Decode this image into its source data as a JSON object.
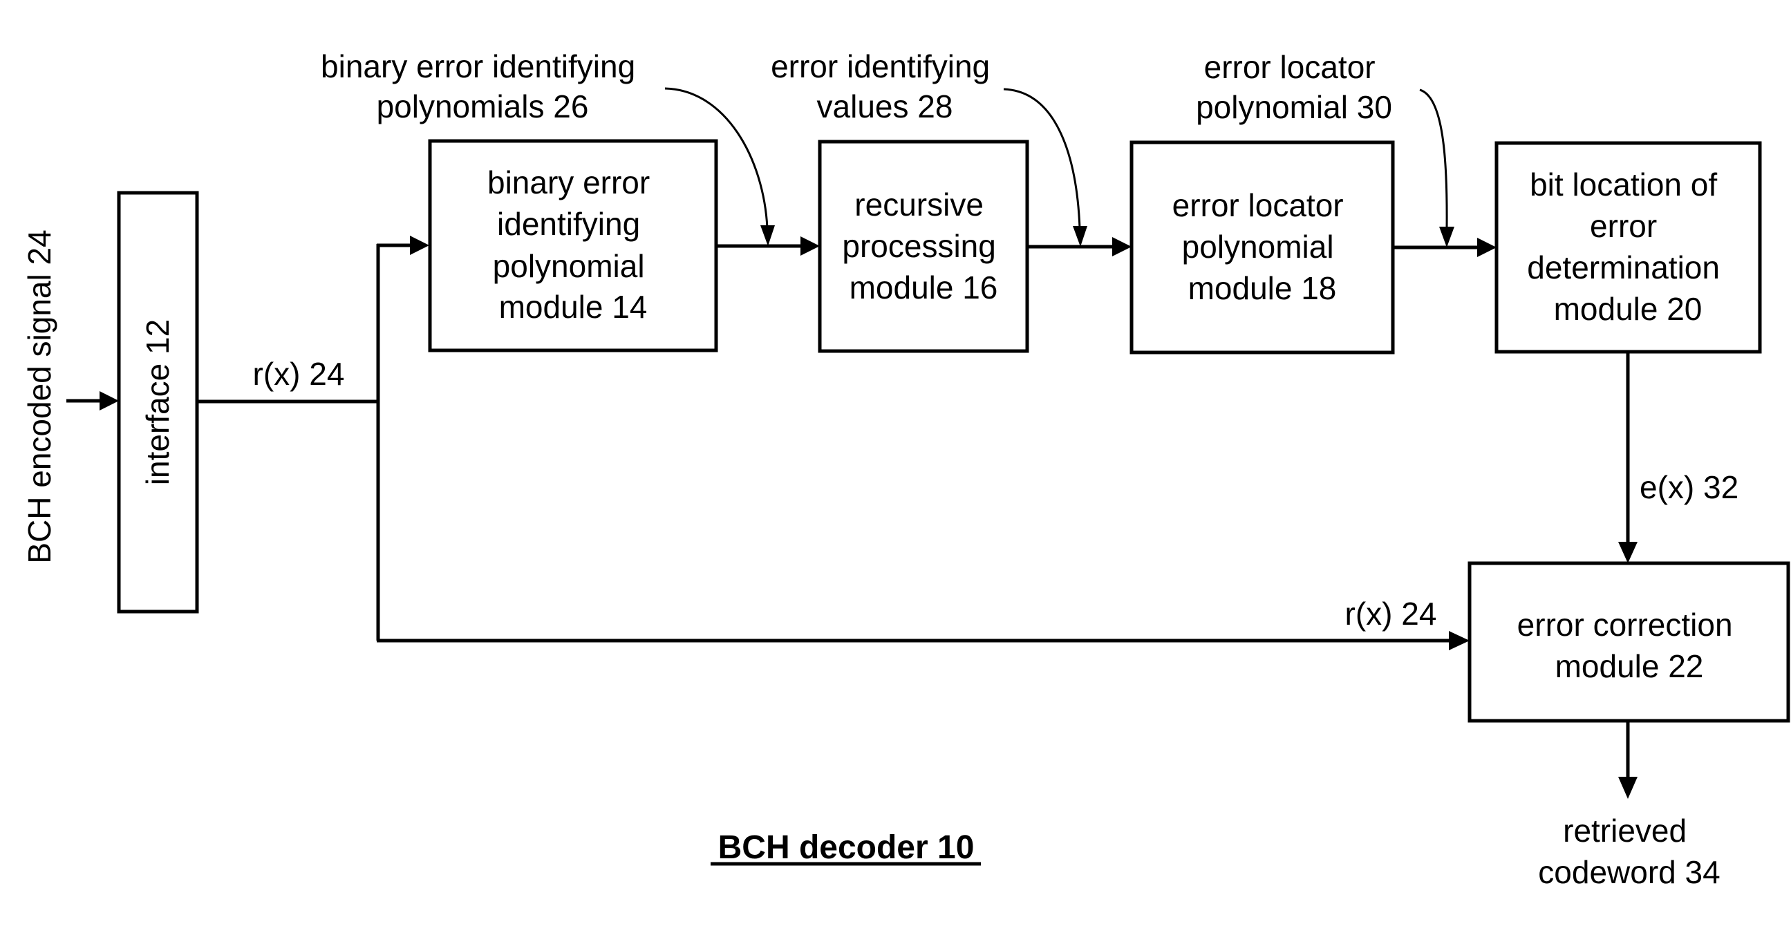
{
  "figure": {
    "title": "BCH decoder 10",
    "input_label": "BCH encoded signal 24",
    "output_label": [
      "retrieved",
      "codeword 34"
    ]
  },
  "blocks": {
    "interface": {
      "label": "interface 12"
    },
    "poly_module": {
      "lines": [
        "binary error",
        "identifying",
        "polynomial",
        "module 14"
      ]
    },
    "recursive_module": {
      "lines": [
        "recursive",
        "processing",
        "module 16"
      ]
    },
    "locator_module": {
      "lines": [
        "error locator",
        "polynomial",
        "module 18"
      ]
    },
    "bit_location_module": {
      "lines": [
        "bit location of",
        "error",
        "determination",
        "module 20"
      ]
    },
    "correction_module": {
      "lines": [
        "error correction",
        "module 22"
      ]
    }
  },
  "signals": {
    "rx_upper": "r(x) 24",
    "rx_lower": "r(x) 24",
    "ex": "e(x) 32",
    "polys_26": [
      "binary error identifying",
      "polynomials 26"
    ],
    "values_28": [
      "error identifying",
      "values 28"
    ],
    "locator_30": [
      "error locator",
      "polynomial 30"
    ]
  },
  "colors": {
    "ink": "#000000",
    "paper": "#ffffff"
  }
}
